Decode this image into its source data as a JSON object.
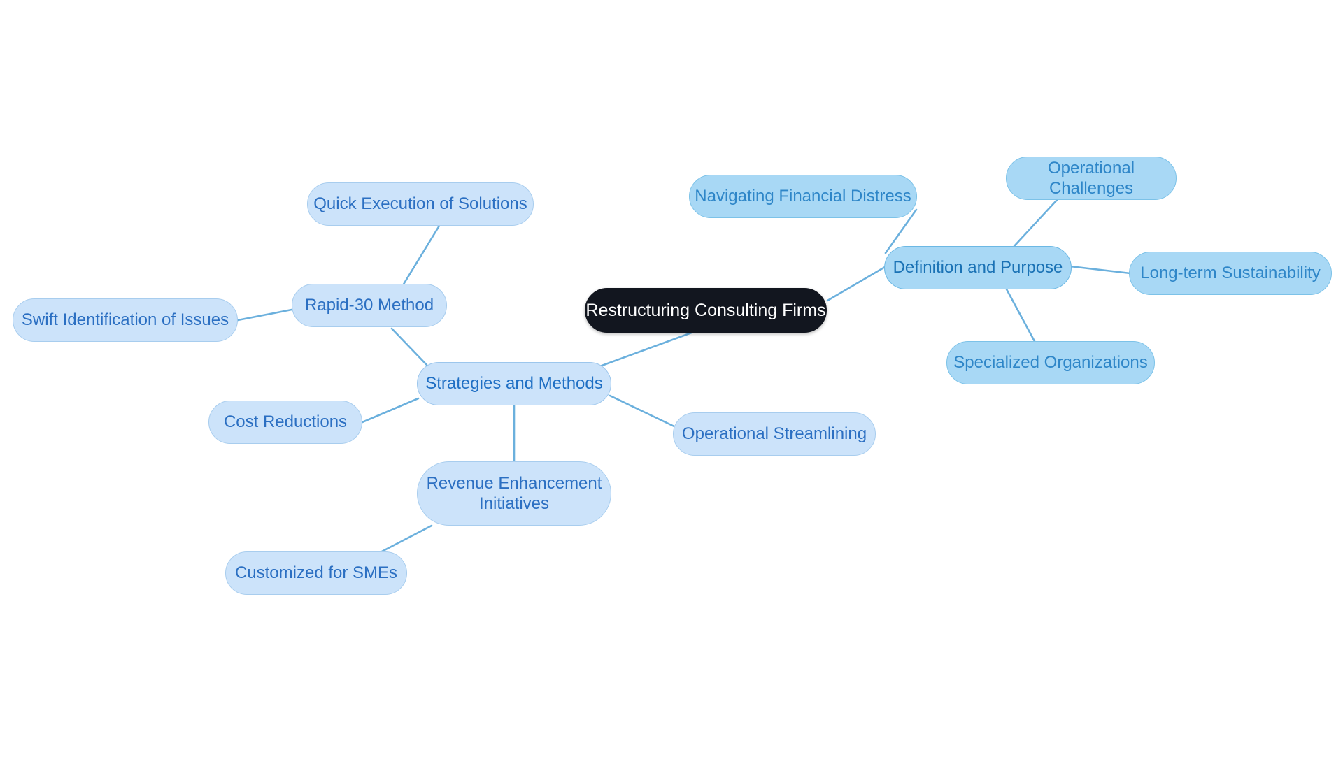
{
  "diagram": {
    "type": "mindmap",
    "title": "Restructuring Consulting Firms",
    "background_color": "#ffffff",
    "edge_color": "#6bb0dd",
    "palette": {
      "root_fill": "#12161f",
      "root_text": "#ffffff",
      "branch_a_fill": "#a8d8f5",
      "branch_a_text": "#1a72b5",
      "branch_b_fill": "#cce3fa",
      "branch_b_text": "#1f6fc4"
    }
  },
  "nodes": {
    "root": {
      "label": "Restructuring Consulting Firms"
    },
    "definition_and_purpose": {
      "label": "Definition and Purpose"
    },
    "navigating_financial_distress": {
      "label": "Navigating Financial Distress"
    },
    "operational_challenges": {
      "label": "Operational Challenges"
    },
    "long_term_sustainability": {
      "label": "Long-term Sustainability"
    },
    "specialized_organizations": {
      "label": "Specialized Organizations"
    },
    "strategies_and_methods": {
      "label": "Strategies and Methods"
    },
    "rapid_30_method": {
      "label": "Rapid-30 Method"
    },
    "quick_execution_of_solutions": {
      "label": "Quick Execution of Solutions"
    },
    "swift_identification_of_issues": {
      "label": "Swift Identification of Issues"
    },
    "cost_reductions": {
      "label": "Cost Reductions"
    },
    "revenue_enhancement_initiatives": {
      "label": "Revenue Enhancement\nInitiatives"
    },
    "customized_for_smes": {
      "label": "Customized for SMEs"
    },
    "operational_streamlining": {
      "label": "Operational Streamlining"
    }
  },
  "edges": [
    {
      "from": "root",
      "to": "definition_and_purpose"
    },
    {
      "from": "root",
      "to": "strategies_and_methods"
    },
    {
      "from": "definition_and_purpose",
      "to": "navigating_financial_distress"
    },
    {
      "from": "definition_and_purpose",
      "to": "operational_challenges"
    },
    {
      "from": "definition_and_purpose",
      "to": "long_term_sustainability"
    },
    {
      "from": "definition_and_purpose",
      "to": "specialized_organizations"
    },
    {
      "from": "strategies_and_methods",
      "to": "rapid_30_method"
    },
    {
      "from": "strategies_and_methods",
      "to": "cost_reductions"
    },
    {
      "from": "strategies_and_methods",
      "to": "revenue_enhancement_initiatives"
    },
    {
      "from": "strategies_and_methods",
      "to": "operational_streamlining"
    },
    {
      "from": "rapid_30_method",
      "to": "quick_execution_of_solutions"
    },
    {
      "from": "rapid_30_method",
      "to": "swift_identification_of_issues"
    },
    {
      "from": "revenue_enhancement_initiatives",
      "to": "customized_for_smes"
    }
  ]
}
